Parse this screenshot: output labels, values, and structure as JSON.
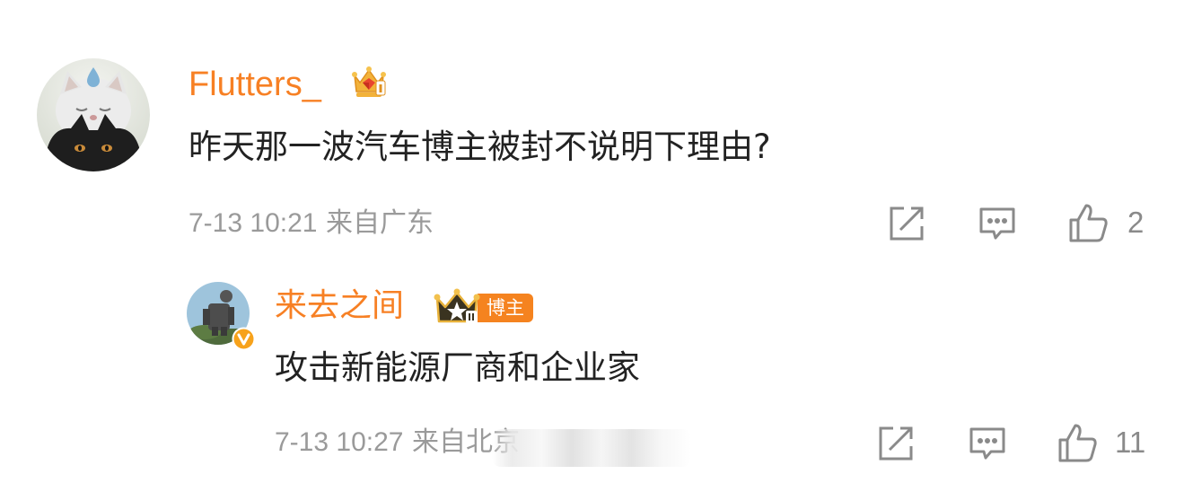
{
  "top_partial_text": "▁▁ ▁▁▁▁",
  "comment": {
    "username": "Flutters_",
    "avatar_icon": "cat-avatar",
    "badge_icon": "crown-gem-icon",
    "text": "昨天那一波汽车博主被封不说明下理由?",
    "time": "7-13 10:21",
    "location": "来自广东",
    "like_count": "2"
  },
  "reply": {
    "username": "来去之间",
    "avatar_icon": "robot-statue-avatar",
    "verified_icon": "verified-v-icon",
    "badge_icon": "crown-level-icon",
    "tag": "博主",
    "text": "攻击新能源厂商和企业家",
    "time": "7-13 10:27",
    "location": "来自北京",
    "like_count": "11"
  },
  "colors": {
    "username": "#f78024",
    "text": "#222222",
    "meta": "#9a9a9a",
    "icon": "#8a8a8a",
    "tag_bg": "#f5831f"
  },
  "icons": {
    "share": "share-icon",
    "comment": "comment-icon",
    "like": "thumbs-up-icon"
  }
}
